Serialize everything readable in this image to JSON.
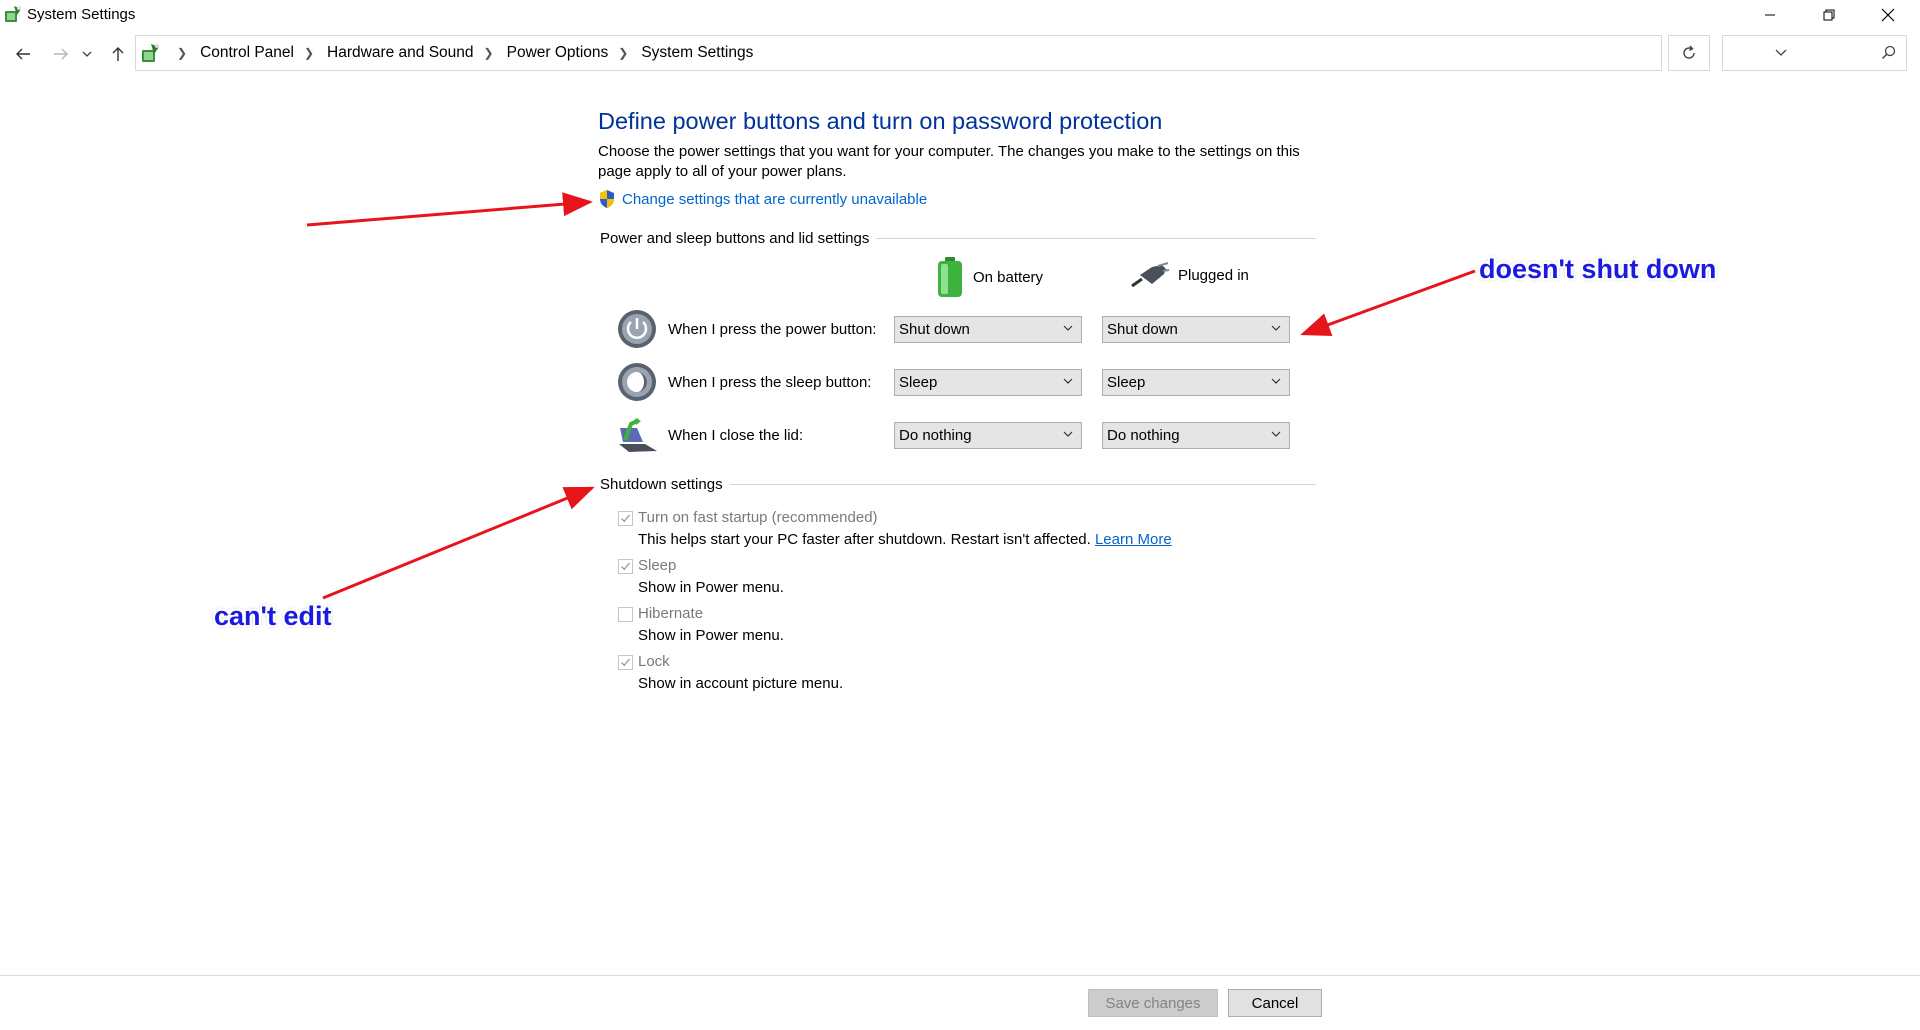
{
  "window": {
    "title": "System Settings"
  },
  "breadcrumb": [
    "Control Panel",
    "Hardware and Sound",
    "Power Options",
    "System Settings"
  ],
  "search": {
    "placeholder": ""
  },
  "main": {
    "title": "Define power buttons and turn on password protection",
    "description": "Choose the power settings that you want for your computer. The changes you make to the settings on this page apply to all of your power plans.",
    "change_link": "Change settings that are currently unavailable",
    "power_section_title": "Power and sleep buttons and lid settings",
    "columns": {
      "battery": "On battery",
      "plugged": "Plugged in"
    },
    "rows": [
      {
        "label": "When I press the power button:",
        "battery": "Shut down",
        "plugged": "Shut down"
      },
      {
        "label": "When I press the sleep button:",
        "battery": "Sleep",
        "plugged": "Sleep"
      },
      {
        "label": "When I close the lid:",
        "battery": "Do nothing",
        "plugged": "Do nothing"
      }
    ],
    "shutdown_section_title": "Shutdown settings",
    "shutdown_items": [
      {
        "label": "Turn on fast startup (recommended)",
        "checked": true,
        "desc": "This helps start your PC faster after shutdown. Restart isn't affected.",
        "link": "Learn More"
      },
      {
        "label": "Sleep",
        "checked": true,
        "desc": "Show in Power menu."
      },
      {
        "label": "Hibernate",
        "checked": false,
        "desc": "Show in Power menu."
      },
      {
        "label": "Lock",
        "checked": true,
        "desc": "Show in account picture menu."
      }
    ]
  },
  "annotations": {
    "right": "doesn't shut down",
    "left": "can't edit"
  },
  "footer": {
    "save_label": "Save changes",
    "cancel_label": "Cancel"
  },
  "colors": {
    "title_blue": "#003399",
    "link_blue": "#0066cc",
    "annotation_blue": "#1a1ae0",
    "arrow_red": "#e8141b"
  }
}
